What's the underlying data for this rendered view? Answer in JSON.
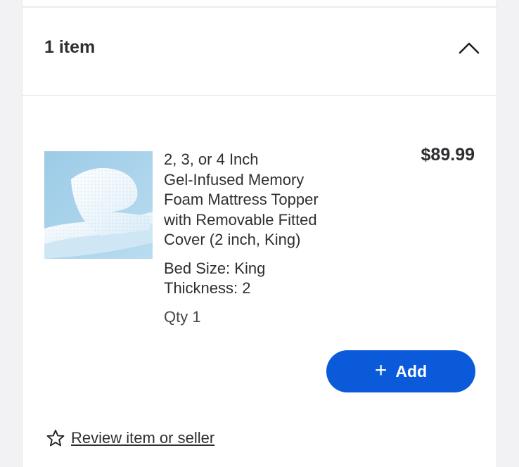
{
  "section": {
    "item_count": "1 item"
  },
  "product": {
    "title_lines": [
      "2, 3, or 4 Inch",
      "Gel-Infused Memory",
      "Foam Mattress Topper",
      "with Removable Fitted",
      "Cover (2 inch, King)"
    ],
    "price": "$89.99",
    "bed_size": "Bed Size: King",
    "thickness": "Thickness: 2",
    "qty": "Qty 1",
    "image_icon": "mattress-topper-photo"
  },
  "actions": {
    "add_label": "Add",
    "add_icon": "plus-icon",
    "review_label": "Review item or seller",
    "review_icon": "star-outline-icon"
  },
  "colors": {
    "accent": "#0a5ada",
    "text": "#2e2f32",
    "background": "#f2f2f4"
  }
}
